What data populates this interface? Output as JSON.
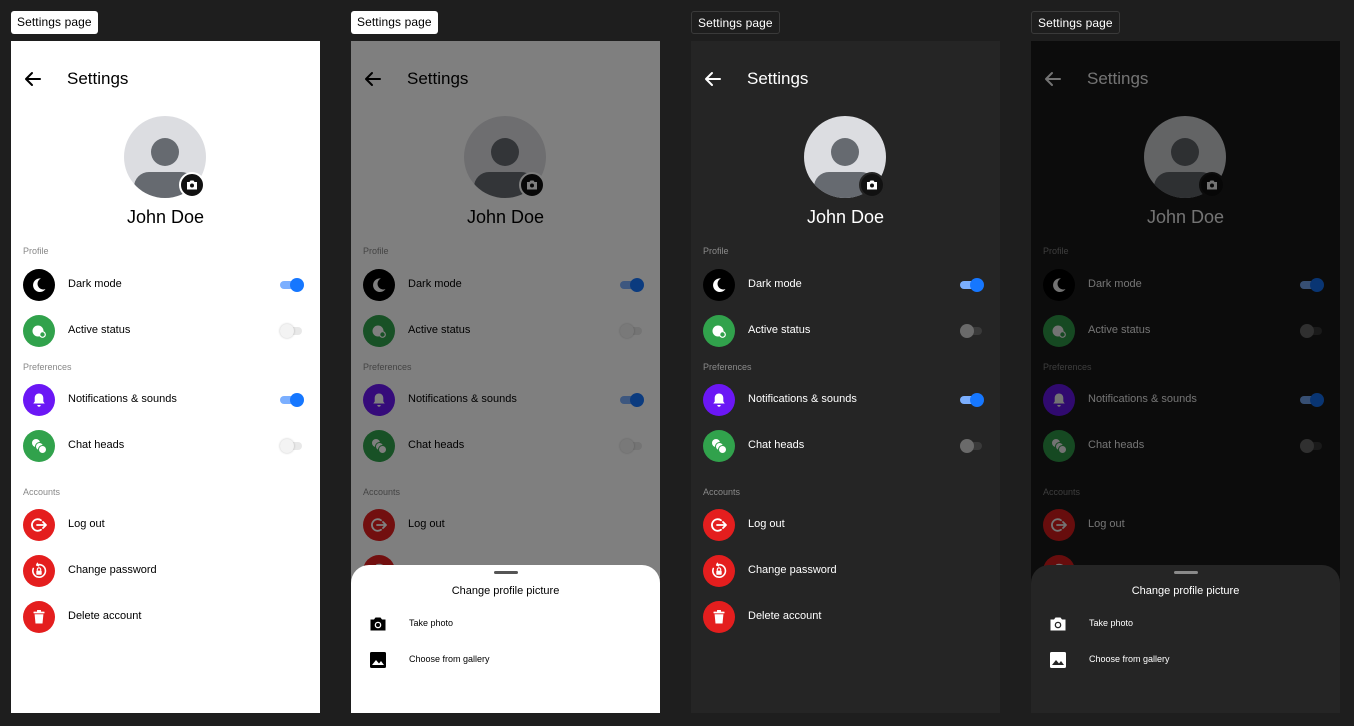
{
  "frame_label": "Settings page",
  "header": {
    "title": "Settings"
  },
  "profile": {
    "name": "John Doe"
  },
  "sections": {
    "profile": "Profile",
    "preferences": "Preferences",
    "accounts": "Accounts"
  },
  "rows": {
    "dark_mode": "Dark mode",
    "active_status": "Active status",
    "notifications": "Notifications & sounds",
    "chat_heads": "Chat heads",
    "log_out": "Log out",
    "change_password": "Change password",
    "delete_account": "Delete account"
  },
  "toggles": {
    "dark_mode": true,
    "active_status": false,
    "notifications": true,
    "chat_heads": false
  },
  "sheet": {
    "title": "Change profile picture",
    "take_photo": "Take photo",
    "choose_gallery": "Choose from gallery"
  },
  "icons": {
    "back": "arrow-left-icon",
    "camera_badge": "camera-icon",
    "dark_mode": "moon-icon",
    "active_status": "status-icon",
    "notifications": "bell-icon",
    "chat_heads": "chat-heads-icon",
    "log_out": "logout-icon",
    "change_password": "lock-reset-icon",
    "delete_account": "trash-icon",
    "take_photo": "camera-icon",
    "choose_gallery": "image-icon"
  },
  "colors": {
    "dark_mode": "#000000",
    "active_status": "#31a24c",
    "notifications": "#6b17f5",
    "chat_heads": "#31a24c",
    "accounts": "#e41e1e",
    "toggle_on": "#1677ff"
  }
}
